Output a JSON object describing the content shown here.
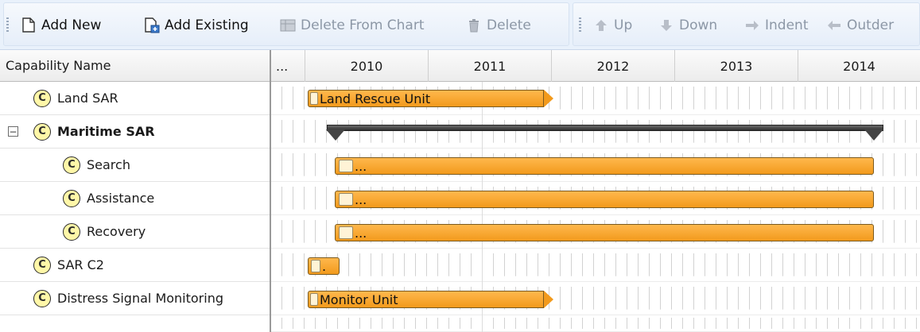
{
  "toolbar": {
    "add_new": "Add New",
    "add_existing": "Add Existing",
    "delete_from_chart": "Delete From Chart",
    "delete": "Delete",
    "up": "Up",
    "down": "Down",
    "indent": "Indent",
    "outdent": "Outder"
  },
  "table": {
    "column_header": "Capability Name",
    "timeline_ellipsis": "...",
    "years": [
      "2010",
      "2011",
      "2012",
      "2013",
      "2014"
    ],
    "rows": [
      {
        "name": "Land SAR",
        "bar_label": "Land Rescue Unit"
      },
      {
        "name": "Maritime SAR",
        "collapse": "−"
      },
      {
        "name": "Search",
        "bar_label": "..."
      },
      {
        "name": "Assistance",
        "bar_label": "..."
      },
      {
        "name": "Recovery",
        "bar_label": "..."
      },
      {
        "name": "SAR C2",
        "bar_label": "."
      },
      {
        "name": "Distress Signal Monitoring",
        "bar_label": "Monitor Unit"
      }
    ],
    "icon_letter": "C"
  },
  "colors": {
    "bar": "#f29a1c",
    "summary": "#3a3a3a",
    "capability_icon": "#fff7a8"
  }
}
